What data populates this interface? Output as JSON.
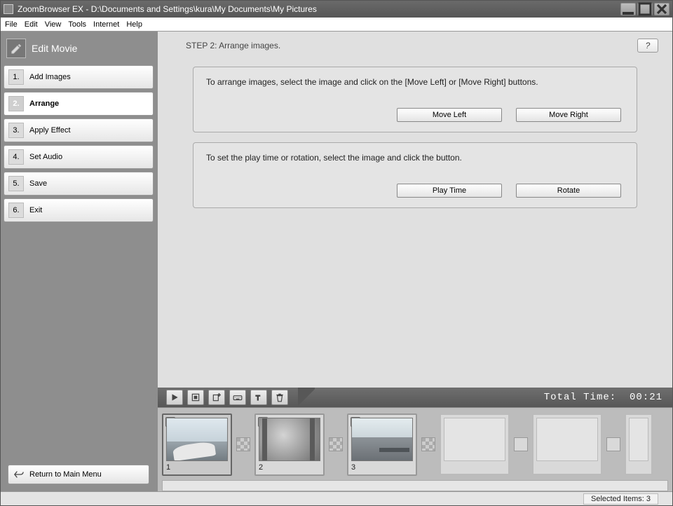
{
  "titlebar": {
    "app": "ZoomBrowser EX",
    "sep": "  -  ",
    "path": "D:\\Documents and Settings\\kura\\My Documents\\My Pictures"
  },
  "menu": {
    "file": "File",
    "edit": "Edit",
    "view": "View",
    "tools": "Tools",
    "internet": "Internet",
    "help": "Help"
  },
  "sidebar": {
    "mode_title": "Edit Movie",
    "steps": [
      {
        "num": "1.",
        "label": "Add Images"
      },
      {
        "num": "2.",
        "label": "Arrange"
      },
      {
        "num": "3.",
        "label": "Apply Effect"
      },
      {
        "num": "4.",
        "label": "Set Audio"
      },
      {
        "num": "5.",
        "label": "Save"
      },
      {
        "num": "6.",
        "label": "Exit"
      }
    ],
    "active_index": 1,
    "return_label": "Return to Main Menu"
  },
  "content": {
    "step_header": "STEP 2: Arrange images.",
    "help_label": "?",
    "panel1_text": "To arrange images, select the image and click on the [Move Left] or [Move Right] buttons.",
    "btn_move_left": "Move Left",
    "btn_move_right": "Move Right",
    "panel2_text": "To set the play time or rotation, select the image and click the button.",
    "btn_play_time": "Play Time",
    "btn_rotate": "Rotate"
  },
  "timeline": {
    "total_time_label": "Total Time:",
    "total_time_value": "00:21",
    "clips": [
      {
        "num": "1"
      },
      {
        "num": "2"
      },
      {
        "num": "3"
      }
    ]
  },
  "statusbar": {
    "selected_label": "Selected Items:",
    "selected_count": "3"
  }
}
